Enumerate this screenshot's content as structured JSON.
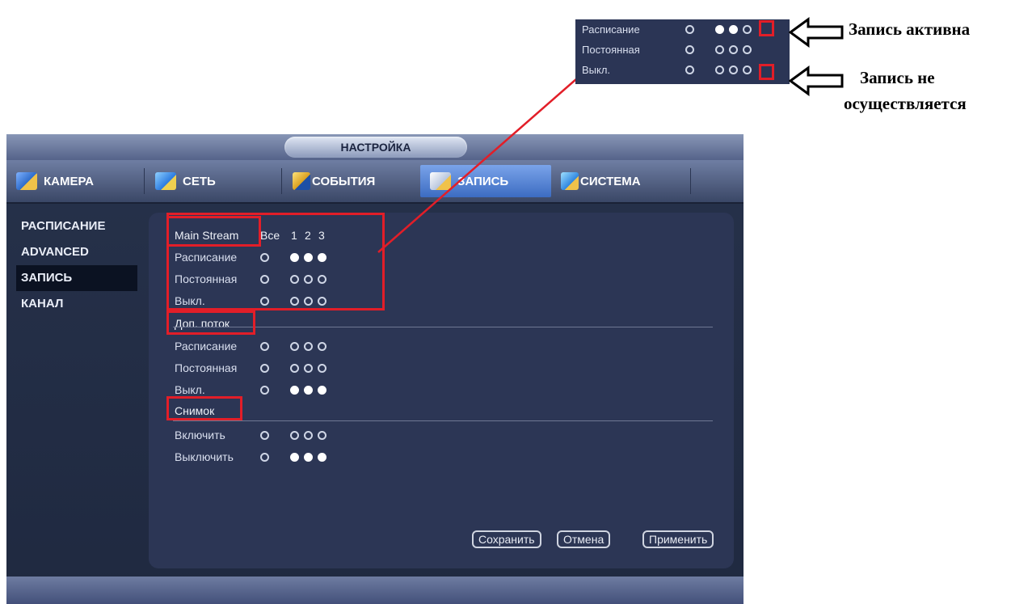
{
  "window": {
    "title": "НАСТРОЙКА"
  },
  "tabs": [
    {
      "label": "КАМЕРА"
    },
    {
      "label": "СЕТЬ"
    },
    {
      "label": "СОБЫТИЯ"
    },
    {
      "label": "ЗАПИСЬ"
    },
    {
      "label": "СИСТЕМА"
    }
  ],
  "active_tab": "ЗАПИСЬ",
  "sidebar": {
    "items": [
      {
        "label": "РАСПИСАНИЕ"
      },
      {
        "label": "ADVANCED"
      },
      {
        "label": "ЗАПИСЬ"
      },
      {
        "label": "КАНАЛ"
      }
    ],
    "active": "ЗАПИСЬ"
  },
  "main_stream": {
    "title": "Main Stream",
    "col_all": "Все",
    "channels": [
      "1",
      "2",
      "3"
    ],
    "rows": [
      {
        "label": "Расписание",
        "all": false,
        "ch": [
          true,
          true,
          true
        ]
      },
      {
        "label": "Постоянная",
        "all": false,
        "ch": [
          false,
          false,
          false
        ]
      },
      {
        "label": "Выкл.",
        "all": false,
        "ch": [
          false,
          false,
          false
        ]
      }
    ]
  },
  "sub_stream": {
    "title": "Доп. поток",
    "rows": [
      {
        "label": "Расписание",
        "all": false,
        "ch": [
          false,
          false,
          false
        ]
      },
      {
        "label": "Постоянная",
        "all": false,
        "ch": [
          false,
          false,
          false
        ]
      },
      {
        "label": "Выкл.",
        "all": false,
        "ch": [
          true,
          true,
          true
        ]
      }
    ]
  },
  "snapshot": {
    "title": "Снимок",
    "rows": [
      {
        "label": "Включить",
        "all": false,
        "ch": [
          false,
          false,
          false
        ]
      },
      {
        "label": "Выключить",
        "all": false,
        "ch": [
          true,
          true,
          true
        ]
      }
    ]
  },
  "buttons": {
    "save": "Сохранить",
    "cancel": "Отмена",
    "apply": "Применить"
  },
  "inset": {
    "rows": [
      {
        "label": "Расписание",
        "all": false,
        "ch": [
          true,
          true,
          false
        ]
      },
      {
        "label": "Постоянная",
        "all": false,
        "ch": [
          false,
          false,
          false
        ]
      },
      {
        "label": "Выкл.",
        "all": false,
        "ch": [
          false,
          false,
          false
        ]
      }
    ]
  },
  "annotations": {
    "active": "Запись активна",
    "inactive_line1": "Запись не",
    "inactive_line2": "осуществляется"
  },
  "colors": {
    "highlight": "#e21e28",
    "active_tab": "#5b86d8"
  }
}
